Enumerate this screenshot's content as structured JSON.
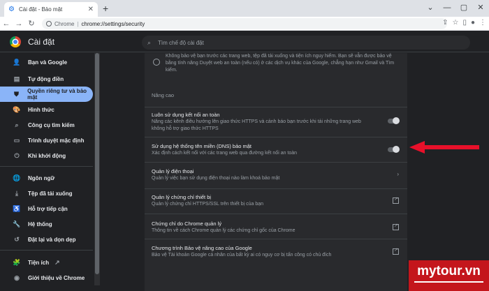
{
  "browser": {
    "tab_title": "Cài đặt - Bảo mật",
    "tab_close": "✕",
    "new_tab": "+",
    "win_controls": [
      "⌄",
      "—",
      "▢",
      "✕"
    ],
    "site_label": "Chrome",
    "url": "chrome://settings/security"
  },
  "header": {
    "title": "Cài đặt",
    "search_placeholder": "Tìm chế độ cài đặt"
  },
  "sidebar": {
    "items": [
      {
        "label": "Bạn và Google",
        "icon": "person-icon"
      },
      {
        "label": "Tự động điền",
        "icon": "clipboard-icon"
      },
      {
        "label": "Quyền riêng tư và bảo mật",
        "icon": "shield-icon"
      },
      {
        "label": "Hình thức",
        "icon": "palette-icon"
      },
      {
        "label": "Công cụ tìm kiếm",
        "icon": "search-icon"
      },
      {
        "label": "Trình duyệt mặc định",
        "icon": "browser-icon"
      },
      {
        "label": "Khi khởi động",
        "icon": "power-icon"
      },
      {
        "label": "Ngôn ngữ",
        "icon": "globe-icon"
      },
      {
        "label": "Tệp đã tải xuống",
        "icon": "download-icon"
      },
      {
        "label": "Hỗ trợ tiếp cận",
        "icon": "accessibility-icon"
      },
      {
        "label": "Hệ thống",
        "icon": "wrench-icon"
      },
      {
        "label": "Đặt lại và dọn dẹp",
        "icon": "reset-icon"
      },
      {
        "label": "Tiện ích",
        "icon": "puzzle-icon"
      },
      {
        "label": "Giới thiệu về Chrome",
        "icon": "chrome-icon"
      }
    ]
  },
  "content": {
    "standard_desc": "Không bảo vệ bạn trước các trang web, tệp đã tải xuống và tiện ích nguy hiểm. Bạn sẽ vẫn được bảo vệ bằng tính năng Duyệt web an toàn (nếu có) ở các dịch vụ khác của Google, chẳng hạn như Gmail và Tìm kiếm.",
    "section_title": "Nâng cao",
    "rows": [
      {
        "title": "Luôn sử dụng kết nối an toàn",
        "sub": "Nâng các kênh điều hướng lên giao thức HTTPS và cảnh báo bạn trước khi tải những trang web không hỗ trợ giao thức HTTPS",
        "control": "toggle"
      },
      {
        "title": "Sử dụng hệ thống tên miền (DNS) bảo mật",
        "sub": "Xác định cách kết nối với các trang web qua đường kết nối an toàn",
        "control": "toggle"
      },
      {
        "title": "Quản lý điện thoại",
        "sub": "Quản lý việc bạn sử dụng điện thoại nào làm khoá bảo mật",
        "control": "chevron"
      },
      {
        "title": "Quản lý chứng chỉ thiết bị",
        "sub": "Quản lý chứng chỉ HTTPS/SSL trên thiết bị của bạn",
        "control": "external"
      },
      {
        "title": "Chứng chỉ do Chrome quản lý",
        "sub": "Thông tin về cách Chrome quản lý các chứng chỉ gốc của Chrome",
        "control": "external"
      },
      {
        "title": "Chương trình Bảo vệ nâng cao của Google",
        "sub": "Bảo vệ Tài khoản Google cá nhân của bất kỳ ai có nguy cơ bị tấn công có chủ đích",
        "control": "external"
      }
    ]
  },
  "watermark": {
    "text": "mytour.vn"
  },
  "colors": {
    "accent": "#8ab4f8",
    "arrow": "#e8102a",
    "watermark_bg": "#c4161c"
  }
}
